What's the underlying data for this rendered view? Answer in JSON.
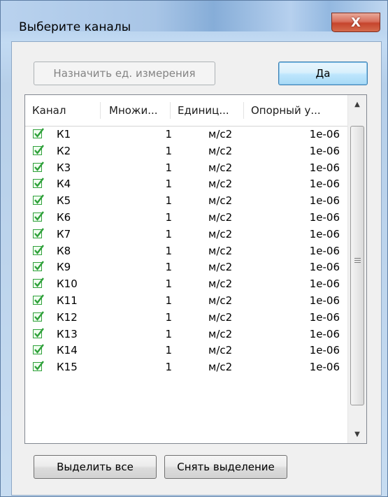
{
  "window": {
    "title": "Выберите каналы",
    "close_glyph": "X"
  },
  "buttons": {
    "assign_units": "Назначить ед. измерения",
    "ok": "Да",
    "select_all": "Выделить все",
    "clear_selection": "Снять выделение"
  },
  "list": {
    "columns": [
      "Канал",
      "Множи...",
      "Единиц...",
      "Опорный у..."
    ],
    "rows": [
      {
        "checked": true,
        "channel": "К1",
        "multiplier": "1",
        "unit": "м/с2",
        "reference": "1e-06"
      },
      {
        "checked": true,
        "channel": "К2",
        "multiplier": "1",
        "unit": "м/с2",
        "reference": "1e-06"
      },
      {
        "checked": true,
        "channel": "К3",
        "multiplier": "1",
        "unit": "м/с2",
        "reference": "1e-06"
      },
      {
        "checked": true,
        "channel": "К4",
        "multiplier": "1",
        "unit": "м/с2",
        "reference": "1e-06"
      },
      {
        "checked": true,
        "channel": "К5",
        "multiplier": "1",
        "unit": "м/с2",
        "reference": "1e-06"
      },
      {
        "checked": true,
        "channel": "К6",
        "multiplier": "1",
        "unit": "м/с2",
        "reference": "1e-06"
      },
      {
        "checked": true,
        "channel": "К7",
        "multiplier": "1",
        "unit": "м/с2",
        "reference": "1e-06"
      },
      {
        "checked": true,
        "channel": "К8",
        "multiplier": "1",
        "unit": "м/с2",
        "reference": "1e-06"
      },
      {
        "checked": true,
        "channel": "К9",
        "multiplier": "1",
        "unit": "м/с2",
        "reference": "1e-06"
      },
      {
        "checked": true,
        "channel": "К10",
        "multiplier": "1",
        "unit": "м/с2",
        "reference": "1e-06"
      },
      {
        "checked": true,
        "channel": "К11",
        "multiplier": "1",
        "unit": "м/с2",
        "reference": "1e-06"
      },
      {
        "checked": true,
        "channel": "К12",
        "multiplier": "1",
        "unit": "м/с2",
        "reference": "1e-06"
      },
      {
        "checked": true,
        "channel": "К13",
        "multiplier": "1",
        "unit": "м/с2",
        "reference": "1e-06"
      },
      {
        "checked": true,
        "channel": "К14",
        "multiplier": "1",
        "unit": "м/с2",
        "reference": "1e-06"
      },
      {
        "checked": true,
        "channel": "К15",
        "multiplier": "1",
        "unit": "м/с2",
        "reference": "1e-06"
      }
    ]
  },
  "icons": {
    "checkbox": "green-check-icon",
    "scroll_up": "chevron-up-icon",
    "scroll_down": "chevron-down-icon",
    "grip": "scroll-grip-icon"
  },
  "colors": {
    "check": "#2fa03a",
    "close": "#c6452d",
    "default_button_border": "#3c7fb1"
  }
}
